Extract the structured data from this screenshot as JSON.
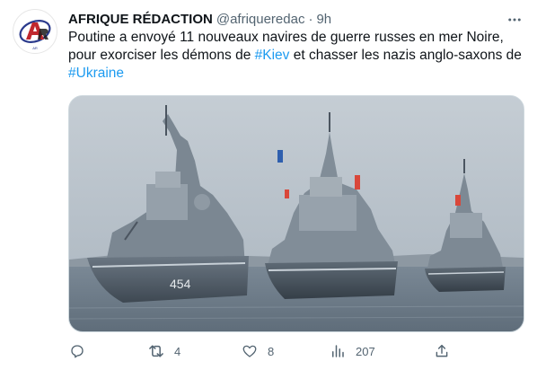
{
  "author": {
    "display_name": "AFRIQUE RÉDACTION",
    "handle": "@afriqueredac",
    "separator": "·",
    "time": "9h",
    "avatar_initials": "AR"
  },
  "text": {
    "part1": "Poutine a envoyé 11 nouveaux navires de guerre russes en mer Noire, pour exorciser les démons de ",
    "hashtag1": "#Kiev",
    "part2": " et chasser les nazis anglo-saxons de ",
    "hashtag2": "#Ukraine"
  },
  "media": {
    "description_icon": "photo",
    "hull_numbers": [
      "454",
      "",
      ""
    ]
  },
  "actions": {
    "reply": {
      "icon": "reply-icon",
      "count": ""
    },
    "retweet": {
      "icon": "retweet-icon",
      "count": "4"
    },
    "like": {
      "icon": "heart-icon",
      "count": "8"
    },
    "views": {
      "icon": "views-icon",
      "count": "207"
    },
    "share": {
      "icon": "share-icon",
      "count": ""
    }
  },
  "colors": {
    "accent": "#1d9bf0",
    "text_primary": "#0f1419",
    "text_secondary": "#536471"
  }
}
